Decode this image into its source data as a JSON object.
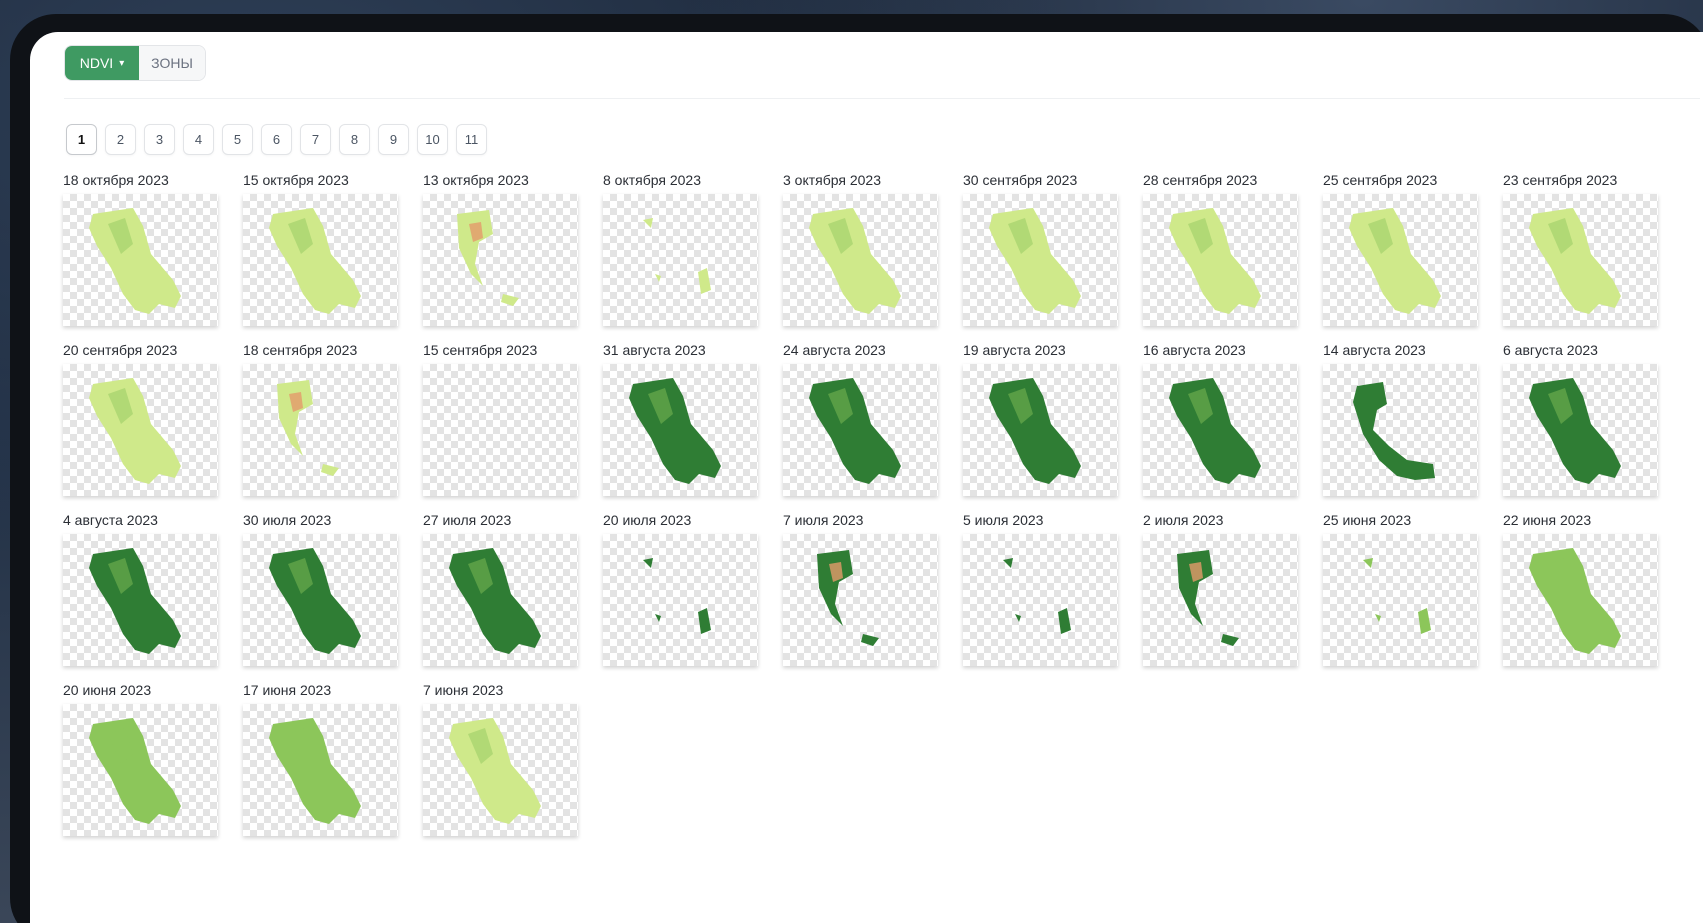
{
  "toolbar": {
    "ndvi_label": "NDVI",
    "zones_label": "ЗОНЫ",
    "close_icon": "close-icon",
    "active_color": "#3f9a62"
  },
  "pagination": {
    "pages": [
      "1",
      "2",
      "3",
      "4",
      "5",
      "6",
      "7",
      "8",
      "9",
      "10",
      "11"
    ],
    "current": "1"
  },
  "palette": {
    "light": "#cfe98a",
    "mid": "#8cc65a",
    "dark": "#2f7d34",
    "stress": "#e39a6a"
  },
  "images": [
    {
      "date": "18 октября 2023",
      "ndvi": "light",
      "coverage": "full"
    },
    {
      "date": "15 октября 2023",
      "ndvi": "light",
      "coverage": "full"
    },
    {
      "date": "13 октября 2023",
      "ndvi": "light",
      "coverage": "partial-stress"
    },
    {
      "date": "8 октября 2023",
      "ndvi": "light",
      "coverage": "fragment"
    },
    {
      "date": "3 октября 2023",
      "ndvi": "light",
      "coverage": "full"
    },
    {
      "date": "30 сентября 2023",
      "ndvi": "light",
      "coverage": "full"
    },
    {
      "date": "28 сентября 2023",
      "ndvi": "light",
      "coverage": "full"
    },
    {
      "date": "25 сентября 2023",
      "ndvi": "light",
      "coverage": "full"
    },
    {
      "date": "23 сентября 2023",
      "ndvi": "light",
      "coverage": "full"
    },
    {
      "date": "20 сентября 2023",
      "ndvi": "light",
      "coverage": "full"
    },
    {
      "date": "18 сентября 2023",
      "ndvi": "light",
      "coverage": "partial-stress"
    },
    {
      "date": "15 сентября 2023",
      "ndvi": "light",
      "coverage": "empty"
    },
    {
      "date": "31 августа 2023",
      "ndvi": "dark",
      "coverage": "full"
    },
    {
      "date": "24 августа 2023",
      "ndvi": "dark",
      "coverage": "full"
    },
    {
      "date": "19 августа 2023",
      "ndvi": "dark",
      "coverage": "full"
    },
    {
      "date": "16 августа 2023",
      "ndvi": "dark",
      "coverage": "full"
    },
    {
      "date": "14 августа 2023",
      "ndvi": "dark",
      "coverage": "partial"
    },
    {
      "date": "6 августа 2023",
      "ndvi": "dark",
      "coverage": "full"
    },
    {
      "date": "4 августа 2023",
      "ndvi": "dark",
      "coverage": "full"
    },
    {
      "date": "30 июля 2023",
      "ndvi": "dark",
      "coverage": "full"
    },
    {
      "date": "27 июля 2023",
      "ndvi": "dark",
      "coverage": "full"
    },
    {
      "date": "20 июля 2023",
      "ndvi": "dark",
      "coverage": "fragment"
    },
    {
      "date": "7 июля 2023",
      "ndvi": "dark",
      "coverage": "partial-stress"
    },
    {
      "date": "5 июля 2023",
      "ndvi": "dark",
      "coverage": "fragment"
    },
    {
      "date": "2 июля 2023",
      "ndvi": "dark",
      "coverage": "partial-stress"
    },
    {
      "date": "25 июня 2023",
      "ndvi": "mid",
      "coverage": "fragment"
    },
    {
      "date": "22 июня 2023",
      "ndvi": "mid",
      "coverage": "full"
    },
    {
      "date": "20 июня 2023",
      "ndvi": "mid",
      "coverage": "full"
    },
    {
      "date": "17 июня 2023",
      "ndvi": "mid",
      "coverage": "full"
    },
    {
      "date": "7 июня 2023",
      "ndvi": "light",
      "coverage": "full"
    }
  ]
}
